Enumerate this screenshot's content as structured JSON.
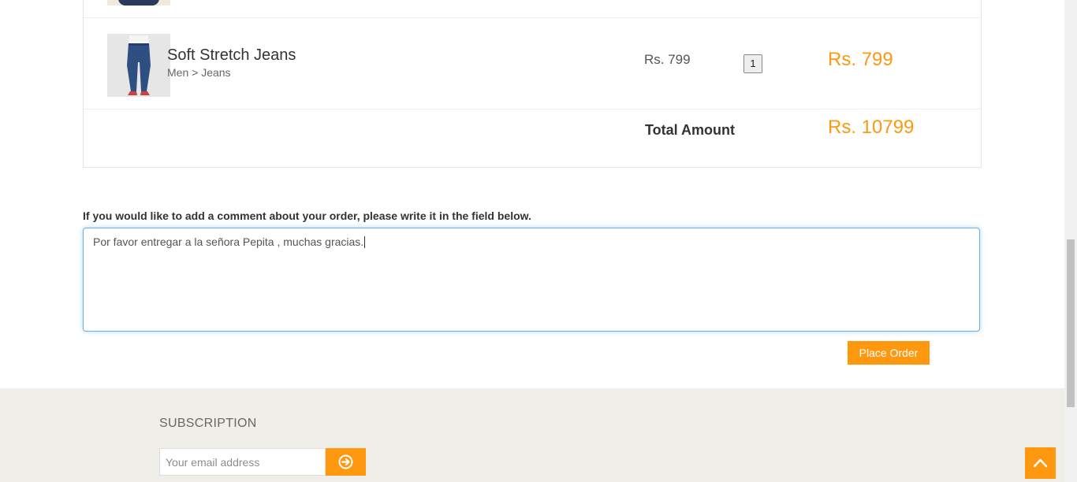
{
  "cart": {
    "item": {
      "name": "Soft Stretch Jeans",
      "category": "Men > Jeans",
      "price": "Rs. 799",
      "quantity": "1",
      "total": "Rs. 799"
    },
    "total_label": "Total Amount",
    "total_value": "Rs. 10799"
  },
  "comment": {
    "label": "If you would like to add a comment about your order, please write it in the field below.",
    "value": "Por favor entregar a la señora Pepita , muchas gracias."
  },
  "place_order_label": "Place Order",
  "footer": {
    "subscription_title": "SUBSCRIPTION",
    "email_placeholder": "Your email address"
  },
  "icons": {
    "subscribe": "arrow-circle-right-icon",
    "scroll_top": "chevron-up-icon"
  },
  "colors": {
    "accent": "#fe980f",
    "footer_bg": "#efeee9"
  }
}
